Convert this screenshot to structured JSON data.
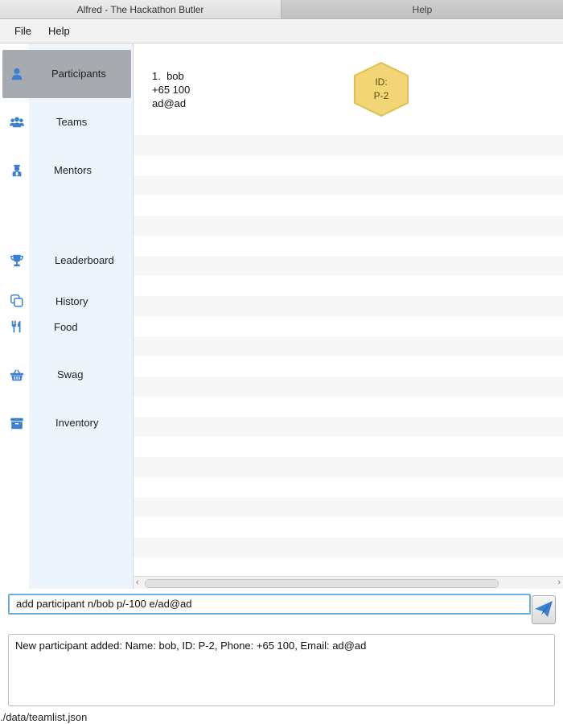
{
  "window_tabs": {
    "active": "Alfred - The Hackathon Butler",
    "inactive": "Help"
  },
  "menu": {
    "file": "File",
    "help": "Help"
  },
  "sidebar": {
    "items": [
      {
        "label": "Participants",
        "icon": "person-icon",
        "selected": true
      },
      {
        "label": "Teams",
        "icon": "group-icon"
      },
      {
        "label": "Mentors",
        "icon": "mentor-icon"
      },
      {
        "label": "Leaderboard",
        "icon": "trophy-icon"
      },
      {
        "label": "History",
        "icon": "copy-icon"
      },
      {
        "label": "Food",
        "icon": "utensils-icon"
      },
      {
        "label": "Swag",
        "icon": "basket-icon"
      },
      {
        "label": "Inventory",
        "icon": "archive-box-icon"
      }
    ],
    "icon_color": "#3b7fd0",
    "selected_color": "#a7aaae"
  },
  "participants": [
    {
      "index": "1.",
      "name": "bob",
      "phone": "+65 100",
      "email": "ad@ad",
      "id_label": "ID:",
      "id": "P-2"
    }
  ],
  "badge_color": "#f2d675",
  "command": {
    "value": "add participant n/bob p/-100 e/ad@ad"
  },
  "result": {
    "text": "New participant added:  Name: bob, ID: P-2, Phone: +65 100, Email: ad@ad"
  },
  "status": {
    "path": "./data/teamlist.json"
  }
}
